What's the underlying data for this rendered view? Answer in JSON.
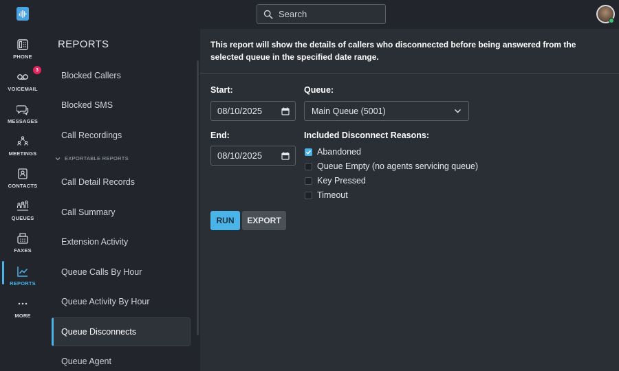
{
  "search": {
    "placeholder": "Search"
  },
  "rail": {
    "items": [
      {
        "label": "PHONE",
        "icon": "phone-icon"
      },
      {
        "label": "VOICEMAIL",
        "icon": "voicemail-icon",
        "badge": "3"
      },
      {
        "label": "MESSAGES",
        "icon": "messages-icon"
      },
      {
        "label": "MEETINGS",
        "icon": "meetings-icon"
      },
      {
        "label": "CONTACTS",
        "icon": "contacts-icon"
      },
      {
        "label": "QUEUES",
        "icon": "queues-icon"
      },
      {
        "label": "FAXES",
        "icon": "fax-icon"
      },
      {
        "label": "REPORTS",
        "icon": "reports-icon",
        "active": true
      },
      {
        "label": "MORE",
        "icon": "more-icon"
      }
    ]
  },
  "reports": {
    "title": "REPORTS",
    "section_label": "EXPORTABLE REPORTS",
    "items": [
      "Blocked Callers",
      "Blocked SMS",
      "Call Recordings",
      "Call Detail Records",
      "Call Summary",
      "Extension Activity",
      "Queue Calls By Hour",
      "Queue Activity By Hour",
      "Queue Disconnects",
      "Queue Agent"
    ],
    "active_item": "Queue Disconnects"
  },
  "main": {
    "description": "This report will show the details of callers who disconnected before being answered from the selected queue in the specified date range.",
    "start_label": "Start:",
    "start_value": "08/10/2025",
    "end_label": "End:",
    "end_value": "08/10/2025",
    "queue_label": "Queue:",
    "queue_value": "Main Queue (5001)",
    "reasons_label": "Included Disconnect Reasons:",
    "reasons": [
      {
        "label": "Abandoned",
        "checked": true
      },
      {
        "label": "Queue Empty (no agents servicing queue)",
        "checked": false
      },
      {
        "label": "Key Pressed",
        "checked": false
      },
      {
        "label": "Timeout",
        "checked": false
      }
    ],
    "run_label": "RUN",
    "export_label": "EXPORT"
  },
  "colors": {
    "accent": "#4ab3e8",
    "badge": "#e0245e",
    "presence": "#3cc46a"
  }
}
